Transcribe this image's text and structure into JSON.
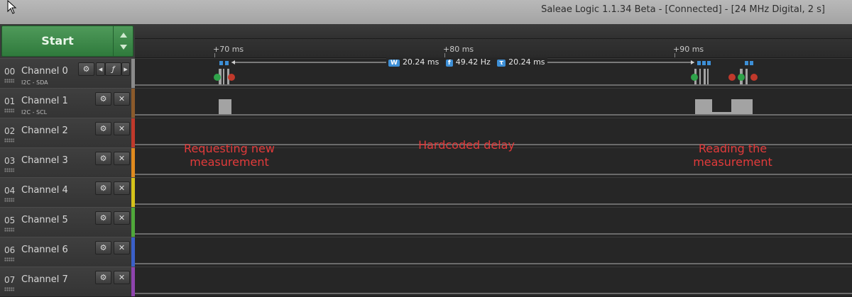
{
  "window": {
    "title": "Saleae Logic 1.1.34 Beta - [Connected] - [24 MHz Digital, 2 s]"
  },
  "start_button": {
    "label": "Start"
  },
  "timeline": {
    "ticks": [
      "+70 ms",
      "+80 ms",
      "+90 ms"
    ]
  },
  "measurement": {
    "width_badge": "W",
    "width": "20.24 ms",
    "freq_badge": "f",
    "freq": "49.42 Hz",
    "period_badge": "τ",
    "period": "20.24 ms"
  },
  "channels": [
    {
      "num": "00",
      "name": "Channel 0",
      "sub": "I2C - SDA",
      "color": "#8a8a8a"
    },
    {
      "num": "01",
      "name": "Channel 1",
      "sub": "I2C - SCL",
      "color": "#8b5a2b"
    },
    {
      "num": "02",
      "name": "Channel 2",
      "sub": "",
      "color": "#c0392b"
    },
    {
      "num": "03",
      "name": "Channel 3",
      "sub": "",
      "color": "#e08a1e"
    },
    {
      "num": "04",
      "name": "Channel 4",
      "sub": "",
      "color": "#d4c21a"
    },
    {
      "num": "05",
      "name": "Channel 5",
      "sub": "",
      "color": "#4fa83a"
    },
    {
      "num": "06",
      "name": "Channel 6",
      "sub": "",
      "color": "#3a5fc8"
    },
    {
      "num": "07",
      "name": "Channel 7",
      "sub": "",
      "color": "#8e44ad"
    }
  ],
  "annotations": {
    "requesting": "Requesting new\nmeasurement",
    "delay": "Hardcoded delay",
    "reading": "Reading the\nmeasurement"
  },
  "icons": {
    "settings": "gear-icon",
    "close": "close-icon",
    "trigger": "trigger-edge-icon"
  }
}
